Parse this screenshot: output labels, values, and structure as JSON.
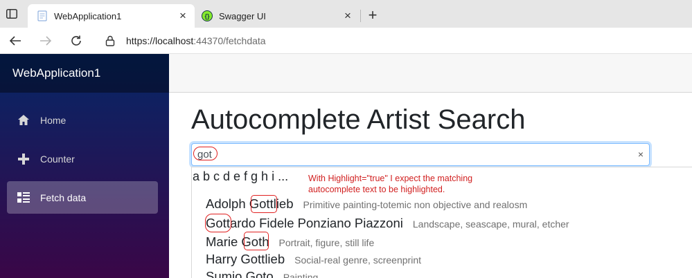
{
  "browser": {
    "tabs": [
      {
        "title": "WebApplication1",
        "close": "×"
      },
      {
        "title": "Swagger UI",
        "close": "×"
      }
    ],
    "new_tab": "+",
    "url_host": "https://localhost",
    "url_rest": ":44370/fetchdata"
  },
  "sidebar": {
    "brand": "WebApplication1",
    "items": [
      {
        "label": "Home",
        "icon": "home-icon"
      },
      {
        "label": "Counter",
        "icon": "plus-icon"
      },
      {
        "label": "Fetch data",
        "icon": "list-icon"
      }
    ]
  },
  "main": {
    "title": "Autocomplete Artist Search",
    "search_value": "got",
    "clear": "×",
    "group_header": "a b c d e f g h i ...",
    "note": "With Highlight=\"true\" I expect the matching autocomplete text to be highlighted.",
    "results": [
      {
        "name": "Adolph Gottlieb",
        "desc": "Primitive painting-totemic non objective and realosm"
      },
      {
        "name": "Gottardo Fidele Ponziano Piazzoni",
        "desc": "Landscape, seascape, mural, etcher"
      },
      {
        "name": "Marie Goth",
        "desc": "Portrait, figure, still life"
      },
      {
        "name": "Harry Gottlieb",
        "desc": "Social-real genre, screenprint"
      },
      {
        "name": "Sumio Goto",
        "desc": "Painting"
      }
    ]
  },
  "colors": {
    "sidebar_top": "#052767",
    "sidebar_bottom": "#3a0647",
    "annotation_red": "#d11f1f",
    "focus_blue": "#80bdff"
  }
}
